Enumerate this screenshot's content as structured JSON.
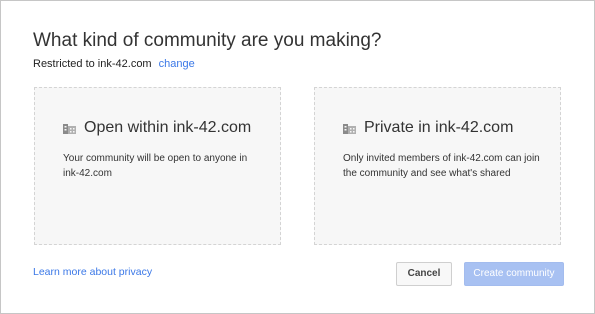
{
  "dialog": {
    "title": "What kind of community are you making?",
    "restricted_text": "Restricted to ink-42.com",
    "change_link": "change"
  },
  "options": [
    {
      "icon": "building-icon",
      "title": "Open within ink-42.com",
      "description": "Your community will be open to anyone in ink-42.com"
    },
    {
      "icon": "building-icon",
      "title": "Private in ink-42.com",
      "description": "Only invited members of ink-42.com can join the community and see what's shared"
    }
  ],
  "footer": {
    "learn_more": "Learn more about privacy",
    "cancel_label": "Cancel",
    "create_label": "Create community"
  },
  "colors": {
    "link": "#3b78e7",
    "card_background": "#f7f7f7",
    "create_button_disabled": "#a8c1f2"
  }
}
